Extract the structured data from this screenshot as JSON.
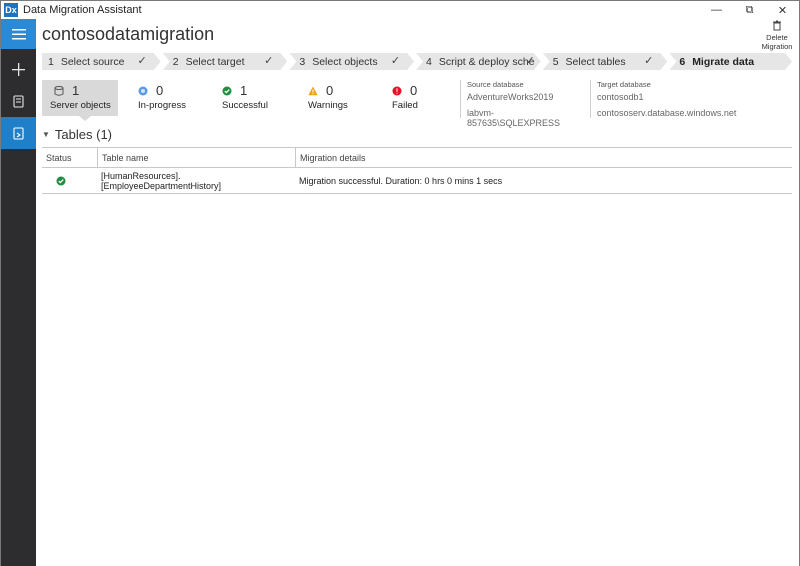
{
  "app": {
    "title": "Data Migration Assistant",
    "logo_text": "Dx",
    "controls": {
      "minimize": "—",
      "maximize": "⧉",
      "close": "✕"
    }
  },
  "nav": {
    "items": [
      {
        "icon": "hamburger-menu-icon"
      },
      {
        "icon": "plus-icon"
      },
      {
        "icon": "assessment-icon"
      },
      {
        "icon": "migration-icon",
        "active": true
      }
    ]
  },
  "header": {
    "migration_name": "contosodatamigration",
    "delete_label_1": "Delete",
    "delete_label_2": "Migration"
  },
  "steps": [
    {
      "num": "1",
      "label": "Select source",
      "done": "✓"
    },
    {
      "num": "2",
      "label": "Select target",
      "done": "✓"
    },
    {
      "num": "3",
      "label": "Select objects",
      "done": "✓"
    },
    {
      "num": "4",
      "label": "Script & deploy sche",
      "done": "✓"
    },
    {
      "num": "5",
      "label": "Select tables",
      "done": "✓"
    },
    {
      "num": "6",
      "label": "Migrate data",
      "done": ""
    }
  ],
  "summary": {
    "server_objects": {
      "count": "1",
      "label": "Server objects"
    },
    "in_progress": {
      "count": "0",
      "label": "In-progress"
    },
    "successful": {
      "count": "1",
      "label": "Successful"
    },
    "warnings": {
      "count": "0",
      "label": "Warnings"
    },
    "failed": {
      "count": "0",
      "label": "Failed"
    }
  },
  "source": {
    "header": "Source database",
    "database": "AdventureWorks2019",
    "server": "labvm-857635\\SQLEXPRESS"
  },
  "target": {
    "header": "Target database",
    "database": "contosodb1",
    "server": "contososerv.database.windows.net"
  },
  "tables": {
    "title": "Tables (1)",
    "columns": [
      "Status",
      "Table name",
      "Migration details"
    ],
    "rows": [
      {
        "status": "success",
        "name": "[HumanResources].[EmployeeDepartmentHistory]",
        "details": "Migration successful. Duration: 0 hrs 0 mins 1 secs"
      }
    ]
  },
  "colors": {
    "accent": "#1f7fc8",
    "success": "#1e8e3e",
    "warning": "#f0a30a",
    "failed": "#e81123",
    "in_progress": "#5a9be0"
  }
}
